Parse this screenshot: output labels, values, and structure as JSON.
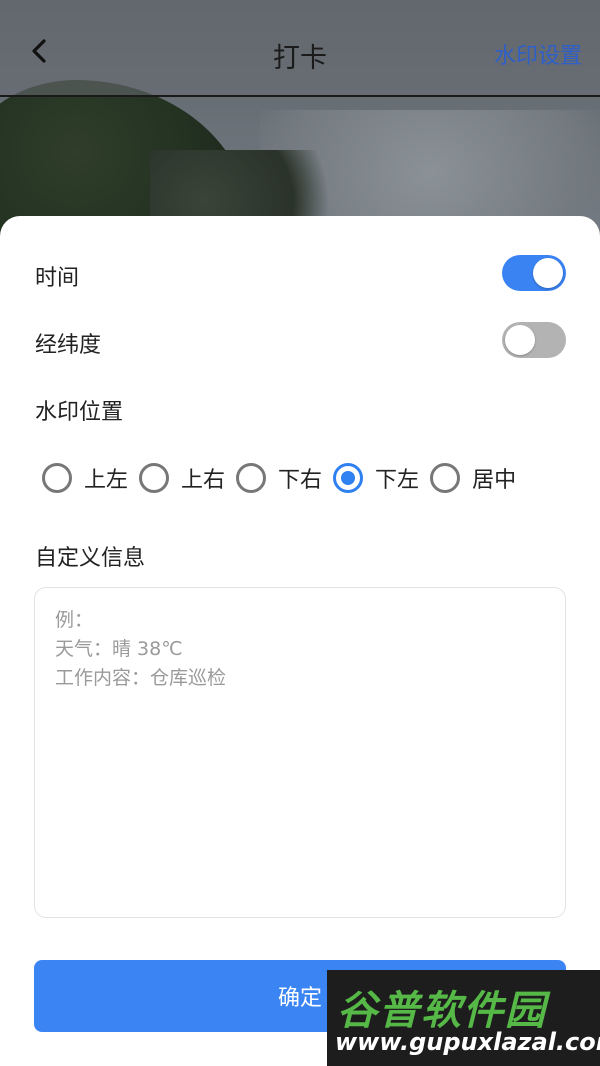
{
  "header": {
    "title": "打卡",
    "watermark_settings_label": "水印设置",
    "back_icon": "chevron-left-icon"
  },
  "settings": {
    "time_label": "时间",
    "time_enabled": true,
    "latlng_label": "经纬度",
    "latlng_enabled": false,
    "position_label": "水印位置",
    "positions": [
      {
        "label": "上左",
        "selected": false
      },
      {
        "label": "上右",
        "selected": false
      },
      {
        "label": "下右",
        "selected": false
      },
      {
        "label": "下左",
        "selected": true
      },
      {
        "label": "居中",
        "selected": false
      }
    ],
    "custom_info_label": "自定义信息",
    "custom_info_placeholder": [
      "例：",
      "天气：晴 38℃",
      "工作内容：仓库巡检"
    ]
  },
  "actions": {
    "confirm_label": "确定"
  },
  "watermark": {
    "brand": "谷普软件园",
    "url": "www.gupuxlazal.com"
  },
  "colors": {
    "accent": "#3a84f3",
    "link": "#2f5fc9",
    "toggle_off": "#b3b3b3"
  }
}
